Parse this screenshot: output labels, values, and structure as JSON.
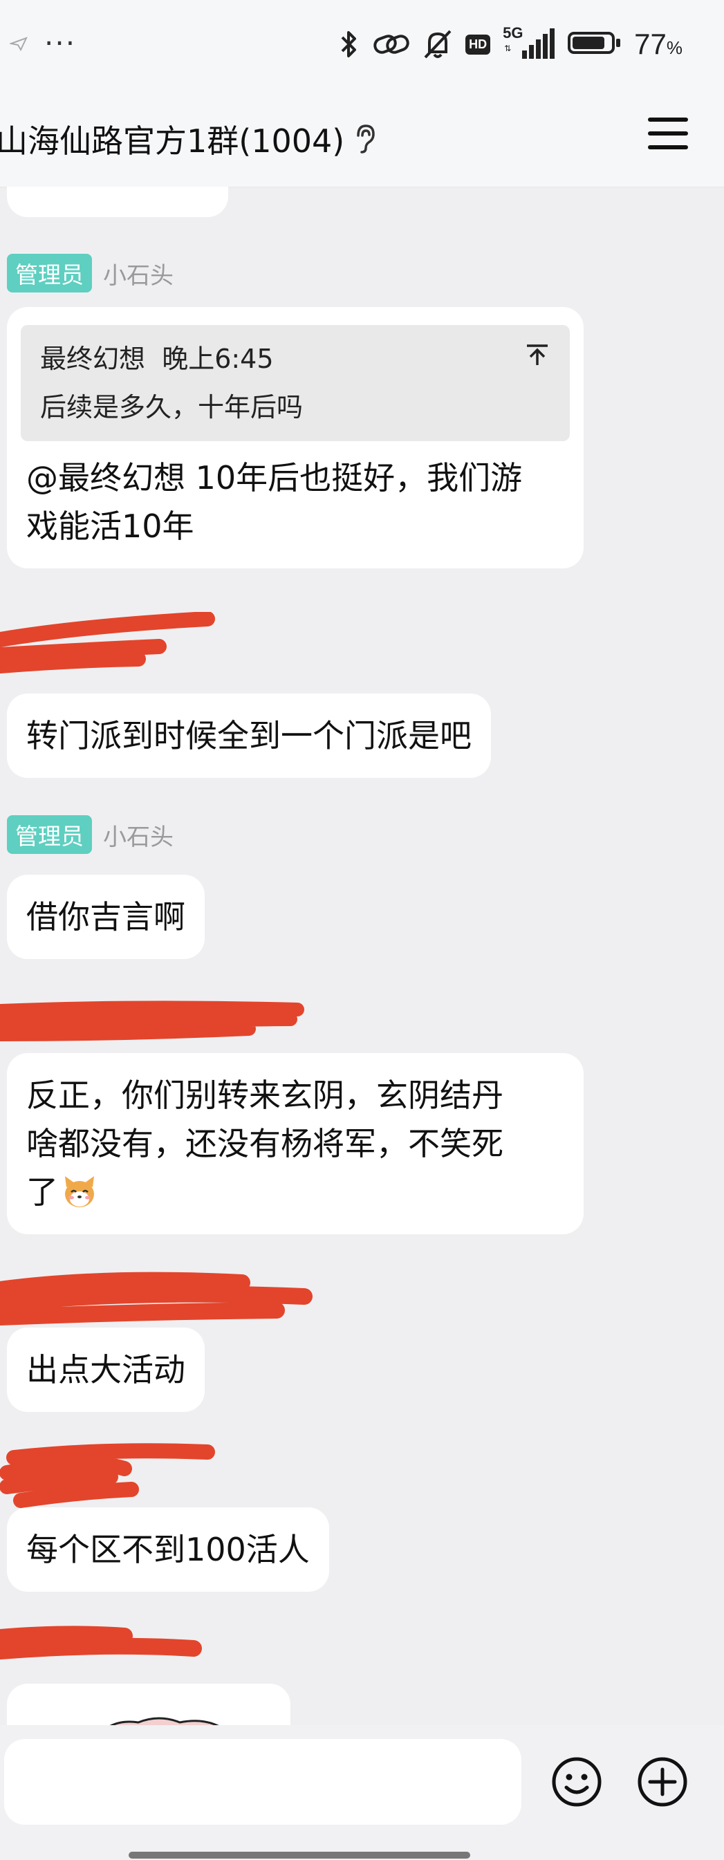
{
  "status_bar": {
    "dots": "···",
    "network": "5G",
    "hd": "HD",
    "battery_number": "77",
    "battery_unit": "%"
  },
  "header": {
    "title": "山海仙路官方1群(1004)"
  },
  "messages": [
    {
      "quote_author": "最终幻想",
      "quote_time": "晚上6:45",
      "quote_text": "后续是多久，十年后吗",
      "badge": "管理员",
      "sender": "小石头",
      "text_line1": "@最终幻想 10年后也挺好，我们游",
      "text_line2": "戏能活10年"
    },
    {
      "text": "转门派到时候全到一个门派是吧"
    },
    {
      "badge": "管理员",
      "sender": "小石头",
      "text": "借你吉言啊"
    },
    {
      "text_line1": "反正，你们别转来玄阴，玄阴结丹",
      "text_line2": "啥都没有，还没有杨将军，不笑死",
      "text_line3": "了"
    },
    {
      "text": "出点大活动"
    },
    {
      "text": "每个区不到100活人"
    }
  ],
  "colors": {
    "badge": "#5ecfc0",
    "redaction": "#e2452c",
    "background": "#efeff1",
    "bubble": "#ffffff"
  },
  "icons": [
    "bluetooth-icon",
    "link-icon",
    "bell-off-icon",
    "signal-icon",
    "battery-icon",
    "ear-icon",
    "menu-icon",
    "emoji-icon",
    "plus-icon",
    "pin-top-icon"
  ]
}
